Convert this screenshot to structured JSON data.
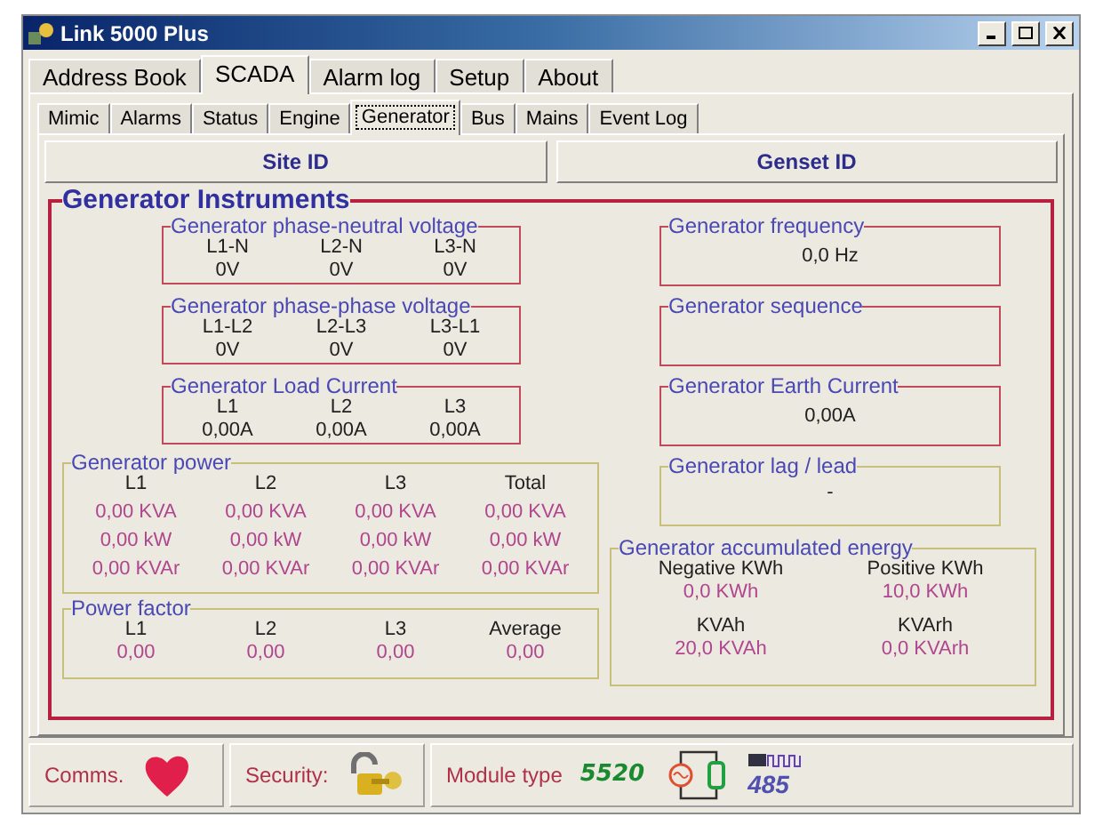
{
  "window": {
    "title": "Link 5000 Plus"
  },
  "main_tabs": [
    {
      "label": "Address Book",
      "selected": false
    },
    {
      "label": "SCADA",
      "selected": true
    },
    {
      "label": "Alarm log",
      "selected": false
    },
    {
      "label": "Setup",
      "selected": false
    },
    {
      "label": "About",
      "selected": false
    }
  ],
  "sub_tabs": [
    {
      "label": "Mimic",
      "selected": false
    },
    {
      "label": "Alarms",
      "selected": false
    },
    {
      "label": "Status",
      "selected": false
    },
    {
      "label": "Engine",
      "selected": false
    },
    {
      "label": "Generator",
      "selected": true
    },
    {
      "label": "Bus",
      "selected": false
    },
    {
      "label": "Mains",
      "selected": false
    },
    {
      "label": "Event Log",
      "selected": false
    }
  ],
  "id_buttons": [
    "Site ID",
    "Genset ID"
  ],
  "instruments": {
    "title": "Generator Instruments",
    "phase_groups": [
      {
        "title": "Generator phase-neutral voltage",
        "columns": [
          {
            "label": "L1-N",
            "value": "0V"
          },
          {
            "label": "L2-N",
            "value": "0V"
          },
          {
            "label": "L3-N",
            "value": "0V"
          }
        ]
      },
      {
        "title": "Generator phase-phase voltage",
        "columns": [
          {
            "label": "L1-L2",
            "value": "0V"
          },
          {
            "label": "L2-L3",
            "value": "0V"
          },
          {
            "label": "L3-L1",
            "value": "0V"
          }
        ]
      },
      {
        "title": "Generator Load Current",
        "columns": [
          {
            "label": "L1",
            "value": "0,00A"
          },
          {
            "label": "L2",
            "value": "0,00A"
          },
          {
            "label": "L3",
            "value": "0,00A"
          }
        ]
      }
    ],
    "single_groups": [
      {
        "title": "Generator frequency",
        "value": "0,0 Hz"
      },
      {
        "title": "Generator sequence"
      },
      {
        "title": "Generator Earth Current",
        "value": "0,00A"
      }
    ],
    "lag_lead": {
      "title": "Generator lag / lead",
      "value": "-"
    },
    "power": {
      "title": "Generator power",
      "headers": [
        "L1",
        "L2",
        "L3",
        "Total"
      ],
      "rows": [
        [
          "0,00 KVA",
          "0,00 KVA",
          "0,00 KVA",
          "0,00 KVA"
        ],
        [
          "0,00 kW",
          "0,00 kW",
          "0,00 kW",
          "0,00 kW"
        ],
        [
          "0,00 KVAr",
          "0,00 KVAr",
          "0,00 KVAr",
          "0,00 KVAr"
        ]
      ]
    },
    "power_factor": {
      "title": "Power factor",
      "headers": [
        "L1",
        "L2",
        "L3",
        "Average"
      ],
      "values": [
        "0,00",
        "0,00",
        "0,00",
        "0,00"
      ]
    },
    "energy": {
      "title": "Generator accumulated energy",
      "items": [
        {
          "label": "Negative KWh",
          "value": "0,0 KWh"
        },
        {
          "label": "Positive KWh",
          "value": "10,0 KWh"
        },
        {
          "label": "KVAh",
          "value": "20,0 KVAh"
        },
        {
          "label": "KVArh",
          "value": "0,0 KVArh"
        }
      ]
    }
  },
  "status_bar": {
    "comms_label": "Comms.",
    "security_label": "Security:",
    "module_label": "Module type",
    "module_number": "5520",
    "protocol": "485"
  }
}
